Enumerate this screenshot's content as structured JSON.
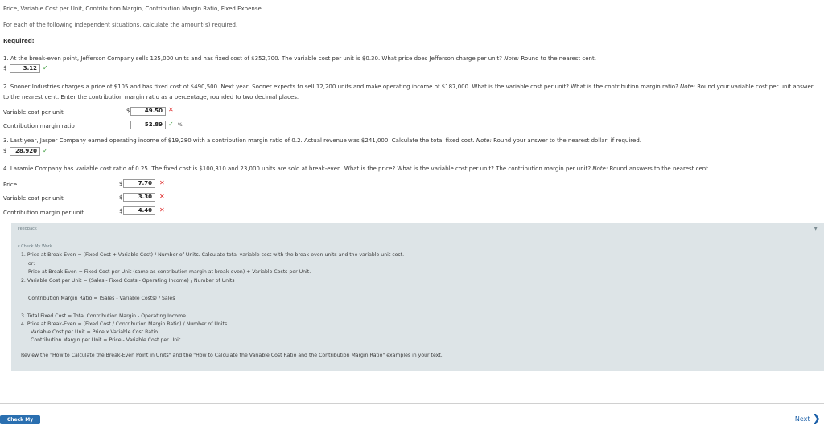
{
  "page": {
    "title": "Price, Variable Cost per Unit, Contribution Margin, Contribution Margin Ratio, Fixed Expense",
    "instructions": "For each of the following independent situations, calculate the amount(s) required.",
    "required_label": "Required:"
  },
  "q1": {
    "text": "1. At the break-even point, Jefferson Company sells 125,000 units and has fixed cost of $352,700. The variable cost per unit is $0.30. What price does Jefferson charge per unit? ",
    "note": "Note:",
    "note_rest": " Round to the nearest cent.",
    "currency": "$",
    "answer": "3.12"
  },
  "q2": {
    "text_line1": "2. Sooner Industries charges a price of $105 and has fixed cost of $490,500. Next year, Sooner expects to sell 12,200 units and make operating income of $187,000. What is the variable cost per unit? What is the contribution margin ratio? ",
    "note": "Note:",
    "note_rest": " Round your variable cost per unit answer",
    "text_line2": "to the nearest cent. Enter the contribution margin ratio as a percentage, rounded to two decimal places.",
    "rows": [
      {
        "label": "Variable cost per unit",
        "currency": "$",
        "value": "49.50",
        "unit": ""
      },
      {
        "label": "Contribution margin ratio",
        "currency": "",
        "value": "52.89",
        "unit": "%"
      }
    ]
  },
  "q3": {
    "text": "3. Last year, Jasper Company earned operating income of $19,280 with a contribution margin ratio of 0.2. Actual revenue was $241,000. Calculate the total fixed cost. ",
    "note": "Note:",
    "note_rest": " Round your answer to the nearest dollar, if required.",
    "currency": "$",
    "answer": "28,920"
  },
  "q4": {
    "text": "4. Laramie Company has variable cost ratio of 0.25. The fixed cost is $100,310 and 23,000 units are sold at break-even. What is the price? What is the variable cost per unit? The contribution margin per unit? ",
    "note": "Note:",
    "note_rest": " Round answers to the nearest cent.",
    "rows": [
      {
        "label": "Price",
        "currency": "$",
        "value": "7.70"
      },
      {
        "label": "Variable cost per unit",
        "currency": "$",
        "value": "3.30"
      },
      {
        "label": "Contribution margin per unit",
        "currency": "$",
        "value": "4.40"
      }
    ]
  },
  "feedback": {
    "title": "Feedback",
    "check_my_work": "Check My Work",
    "lines": [
      "1. Price at Break-Even = (Fixed Cost + Variable Cost) / Number of Units. Calculate total variable cost with the break-even units and the variable unit cost.",
      "or:",
      "Price at Break-Even = Fixed Cost per Unit (same as contribution margin at break-even) + Variable Costs per Unit.",
      "2. Variable Cost per Unit = (Sales - Fixed Costs - Operating Income) / Number of Units",
      "Contribution Margin Ratio = (Sales - Variable Costs) / Sales",
      "3. Total Fixed Cost = Total Contribution Margin - Operating Income",
      "4. Price at Break-Even = (Fixed Cost / Contribution Margin Ratio) / Number of Units",
      "Variable Cost per Unit = Price x Variable Cost Ratio",
      "Contribution Margin per Unit = Price - Variable Cost per Unit",
      "Review the \"How to Calculate the Break-Even Point in Units\" and the \"How to Calculate the Variable Cost Ratio and the Contribution Margin Ratio\" examples in your text."
    ]
  },
  "footer": {
    "check_button": "Check My Work",
    "next_label": "Next"
  },
  "icons": {
    "correct": "checkmark-icon",
    "incorrect": "x-icon"
  },
  "colors": {
    "correct": "#3a9a3a",
    "incorrect": "#dd2222",
    "feedback_bg": "#dde4e7",
    "button": "#2a6fb0"
  }
}
